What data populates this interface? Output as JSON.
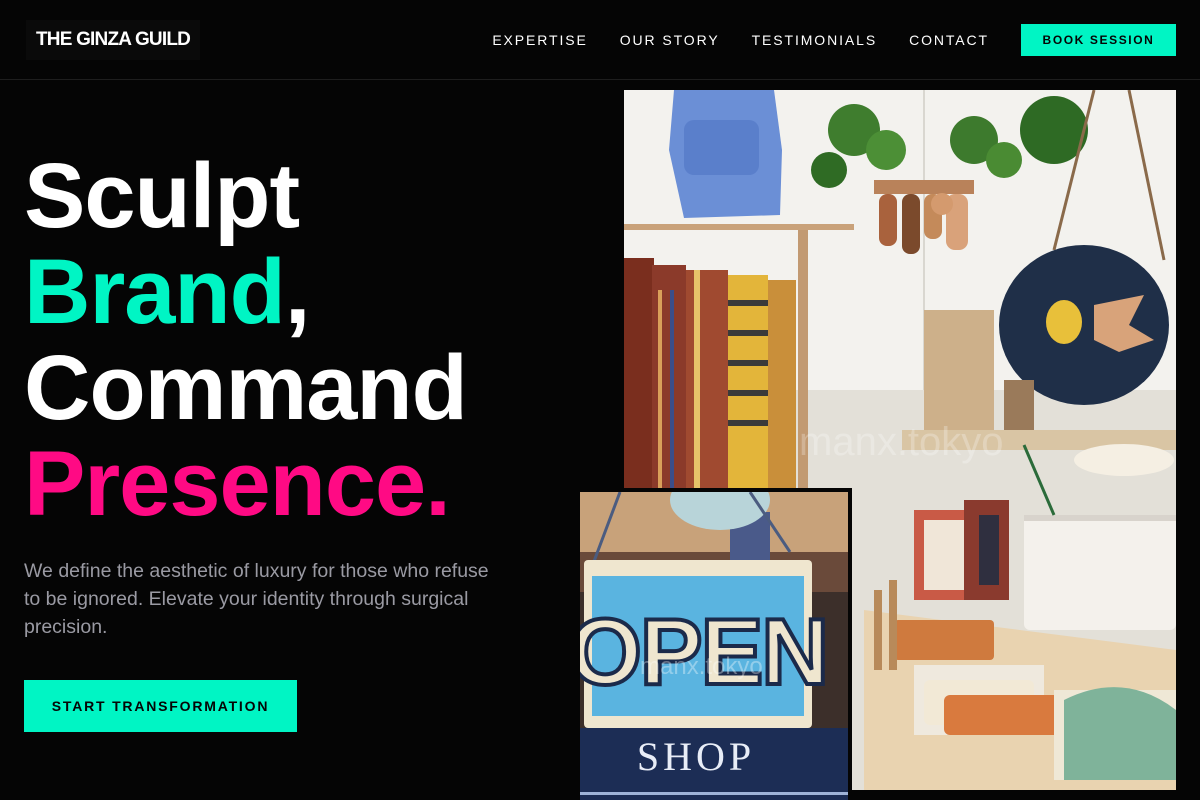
{
  "header": {
    "logo": "THE GINZA GUILD",
    "nav": [
      "EXPERTISE",
      "OUR STORY",
      "TESTIMONIALS",
      "CONTACT"
    ],
    "book_label": "BOOK SESSION"
  },
  "hero": {
    "title_word_1": "Sculpt",
    "title_word_2": "Brand",
    "title_comma": ",",
    "title_word_3": "Command",
    "title_word_4": "Presence",
    "title_period": ".",
    "subtitle": "We define the aesthetic of luxury for those who refuse to be ignored. Elevate your identity through surgical precision.",
    "cta_label": "START TRANSFORMATION"
  },
  "images": {
    "main_watermark": "manx.tokyo",
    "sign_word": "OPEN",
    "sign_shop": "SHOP",
    "sign_watermark": "manx.tokyo"
  },
  "colors": {
    "background": "#050505",
    "accent_teal": "#00f5c4",
    "accent_pink": "#ff0a84",
    "muted_text": "#9a9aa3"
  }
}
